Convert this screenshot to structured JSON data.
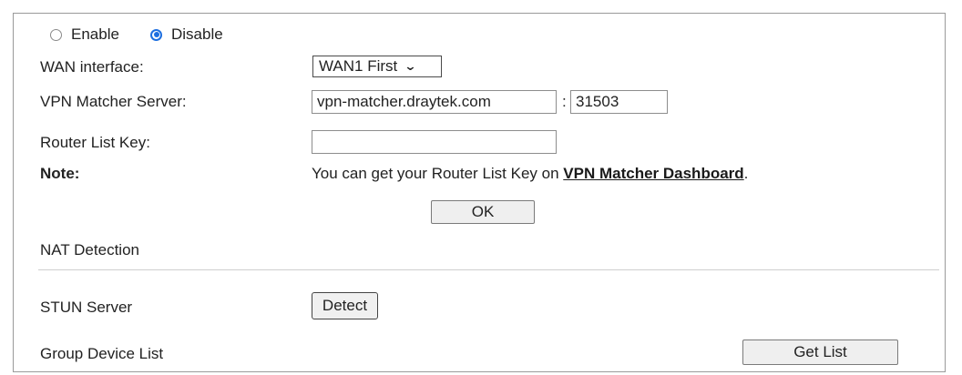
{
  "mode": {
    "enable_label": "Enable",
    "disable_label": "Disable",
    "selected": "Disable"
  },
  "wan_interface": {
    "label": "WAN interface:",
    "value": "WAN1 First"
  },
  "vpn_matcher_server": {
    "label": "VPN Matcher Server:",
    "host": "vpn-matcher.draytek.com",
    "separator": ":",
    "port": "31503"
  },
  "router_list_key": {
    "label": "Router List Key:",
    "value": ""
  },
  "note": {
    "label": "Note:",
    "text_before": "You can get your Router List Key on ",
    "link_text": "VPN Matcher Dashboard",
    "text_after": "."
  },
  "ok_button": "OK",
  "nat_detection": {
    "heading": "NAT Detection",
    "stun_label": "STUN Server",
    "detect_button": "Detect"
  },
  "group_device_list": {
    "label": "Group Device List",
    "get_list_button": "Get List"
  },
  "colors": {
    "radio_accent": "#1e6fe0",
    "border": "#9a9a9a"
  }
}
